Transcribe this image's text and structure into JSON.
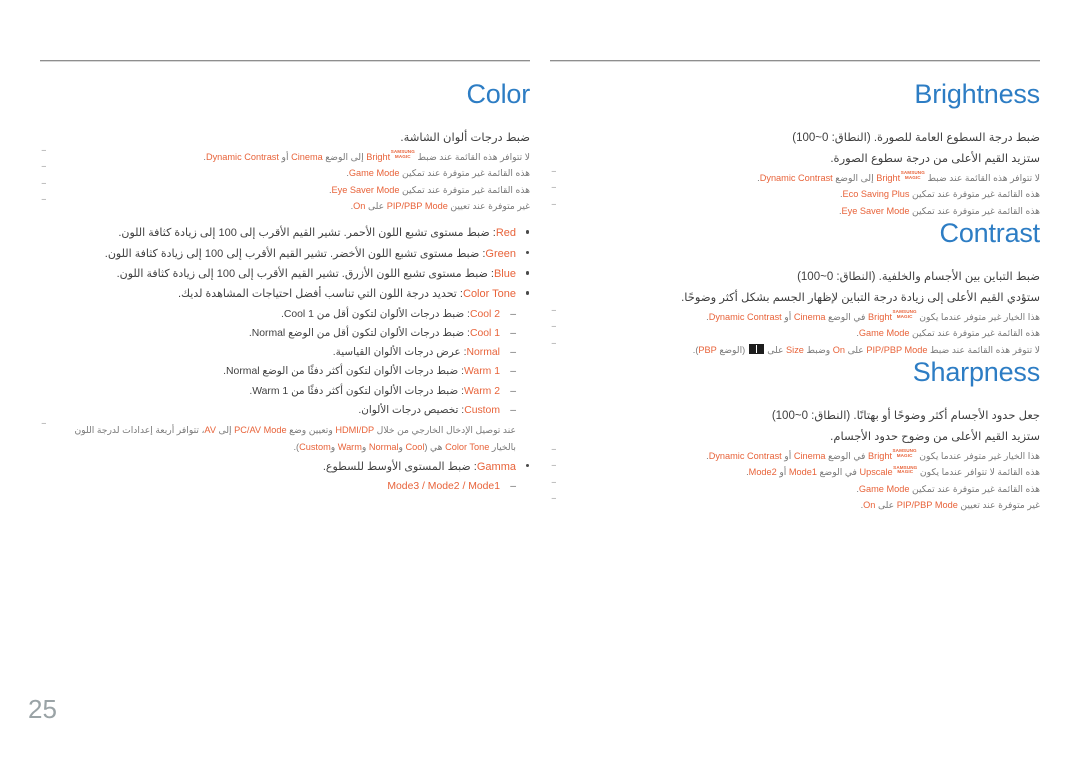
{
  "page": {
    "number": "25",
    "accent_color": "#e8633a",
    "heading_color": "#2d7dc4",
    "rule_color": "#8e8e8e"
  },
  "left_column": {
    "title": "Color",
    "lead": "ضبط درجات ألوان الشاشة.",
    "notes": [
      "لا تتوافر هذه القائمة عند ضبط [MAGIC]Bright إلى الوضع Cinema أو Dynamic Contrast.",
      "هذه القائمة غير متوفرة عند تمكين Game Mode.",
      "هذه القائمة غير متوفرة عند تمكين Eye Saver Mode.",
      "غير متوفرة عند تعيين PIP/PBP Mode على On."
    ],
    "bullets": [
      {
        "term": "Red",
        "text": ": ضبط مستوى تشبع اللون الأحمر. تشير القيم الأقرب إلى 100 إلى زيادة كثافة اللون."
      },
      {
        "term": "Green",
        "text": ": ضبط مستوى تشبع اللون الأخضر. تشير القيم الأقرب إلى 100 إلى زيادة كثافة اللون."
      },
      {
        "term": "Blue",
        "text": ": ضبط مستوى تشبع اللون الأزرق. تشير القيم الأقرب إلى 100 إلى زيادة كثافة اللون."
      },
      {
        "term": "Color Tone",
        "text": ": تحديد درجة اللون التي تناسب أفضل احتياجات المشاهدة لديك."
      }
    ],
    "color_tone_options": [
      {
        "term": "Cool 2",
        "text": ": ضبط درجات الألوان لتكون أقل من Cool 1."
      },
      {
        "term": "Cool 1",
        "text": ": ضبط درجات الألوان لتكون أقل من الوضع Normal."
      },
      {
        "term": "Normal",
        "text": ": عرض درجات الألوان القياسية."
      },
      {
        "term": "Warm 1",
        "text": ": ضبط درجات الألوان لتكون أكثر دفئًا من الوضع Normal."
      },
      {
        "term": "Warm 2",
        "text": ": ضبط درجات الألوان لتكون أكثر دفئًا من Warm 1."
      },
      {
        "term": "Custom",
        "text": ": تخصيص درجات الألوان."
      }
    ],
    "color_tone_note": "عند توصيل الإدخال الخارجي من خلال HDMI/DP وتعيين وضع PC/AV Mode إلى AV، تتوافر أربعة إعدادات لدرجة اللون بالخيار Color Tone هي (Cool وNormal وWarm وCustom).",
    "gamma_bullet": {
      "term": "Gamma",
      "text": ": ضبط المستوى الأوسط للسطوع."
    },
    "gamma_options": "Mode3 / Mode2 / Mode1"
  },
  "right_column": {
    "sections": [
      {
        "title": "Brightness",
        "leads": [
          "ضبط درجة السطوع العامة للصورة. (النطاق: 0~100)",
          "ستزيد القيم الأعلى من درجة سطوع الصورة."
        ],
        "notes": [
          "لا تتوافر هذه القائمة عند ضبط [MAGIC]Bright إلى الوضع Dynamic Contrast.",
          "هذه القائمة غير متوفرة عند تمكين Eco Saving Plus.",
          "هذه القائمة غير متوفرة عند تمكين Eye Saver Mode."
        ]
      },
      {
        "title": "Contrast",
        "leads": [
          "ضبط التباين بين الأجسام والخلفية. (النطاق: 0~100)",
          "ستؤدي القيم الأعلى إلى زيادة درجة التباين لإظهار الجسم بشكل أكثر وضوحًا."
        ],
        "notes": [
          "هذا الخيار غير متوفر عندما يكون [MAGIC]Bright في الوضع Cinema أو Dynamic Contrast.",
          "هذه القائمة غير متوفرة عند تمكين Game Mode.",
          "لا تتوفر هذه القائمة عند ضبط PIP/PBP Mode على On وضبط Size على [ICON] (الوضع PBP)."
        ]
      },
      {
        "title": "Sharpness",
        "leads": [
          "جعل حدود الأجسام أكثر وضوحًا أو بهتانًا. (النطاق: 0~100)",
          "ستزيد القيم الأعلى من وضوح حدود الأجسام."
        ],
        "notes": [
          "هذا الخيار غير متوفر عندما يكون [MAGIC]Bright في الوضع Cinema أو Dynamic Contrast.",
          "هذه القائمة لا تتوافر عندما يكون [MAGIC]Upscale في الوضع Mode1 أو Mode2.",
          "هذه القائمة غير متوفرة عند تمكين Game Mode.",
          "غير متوفرة عند تعيين PIP/PBP Mode على On."
        ]
      }
    ]
  },
  "magic_logo": {
    "line1": "SAMSUNG",
    "line2": "MAGIC"
  }
}
